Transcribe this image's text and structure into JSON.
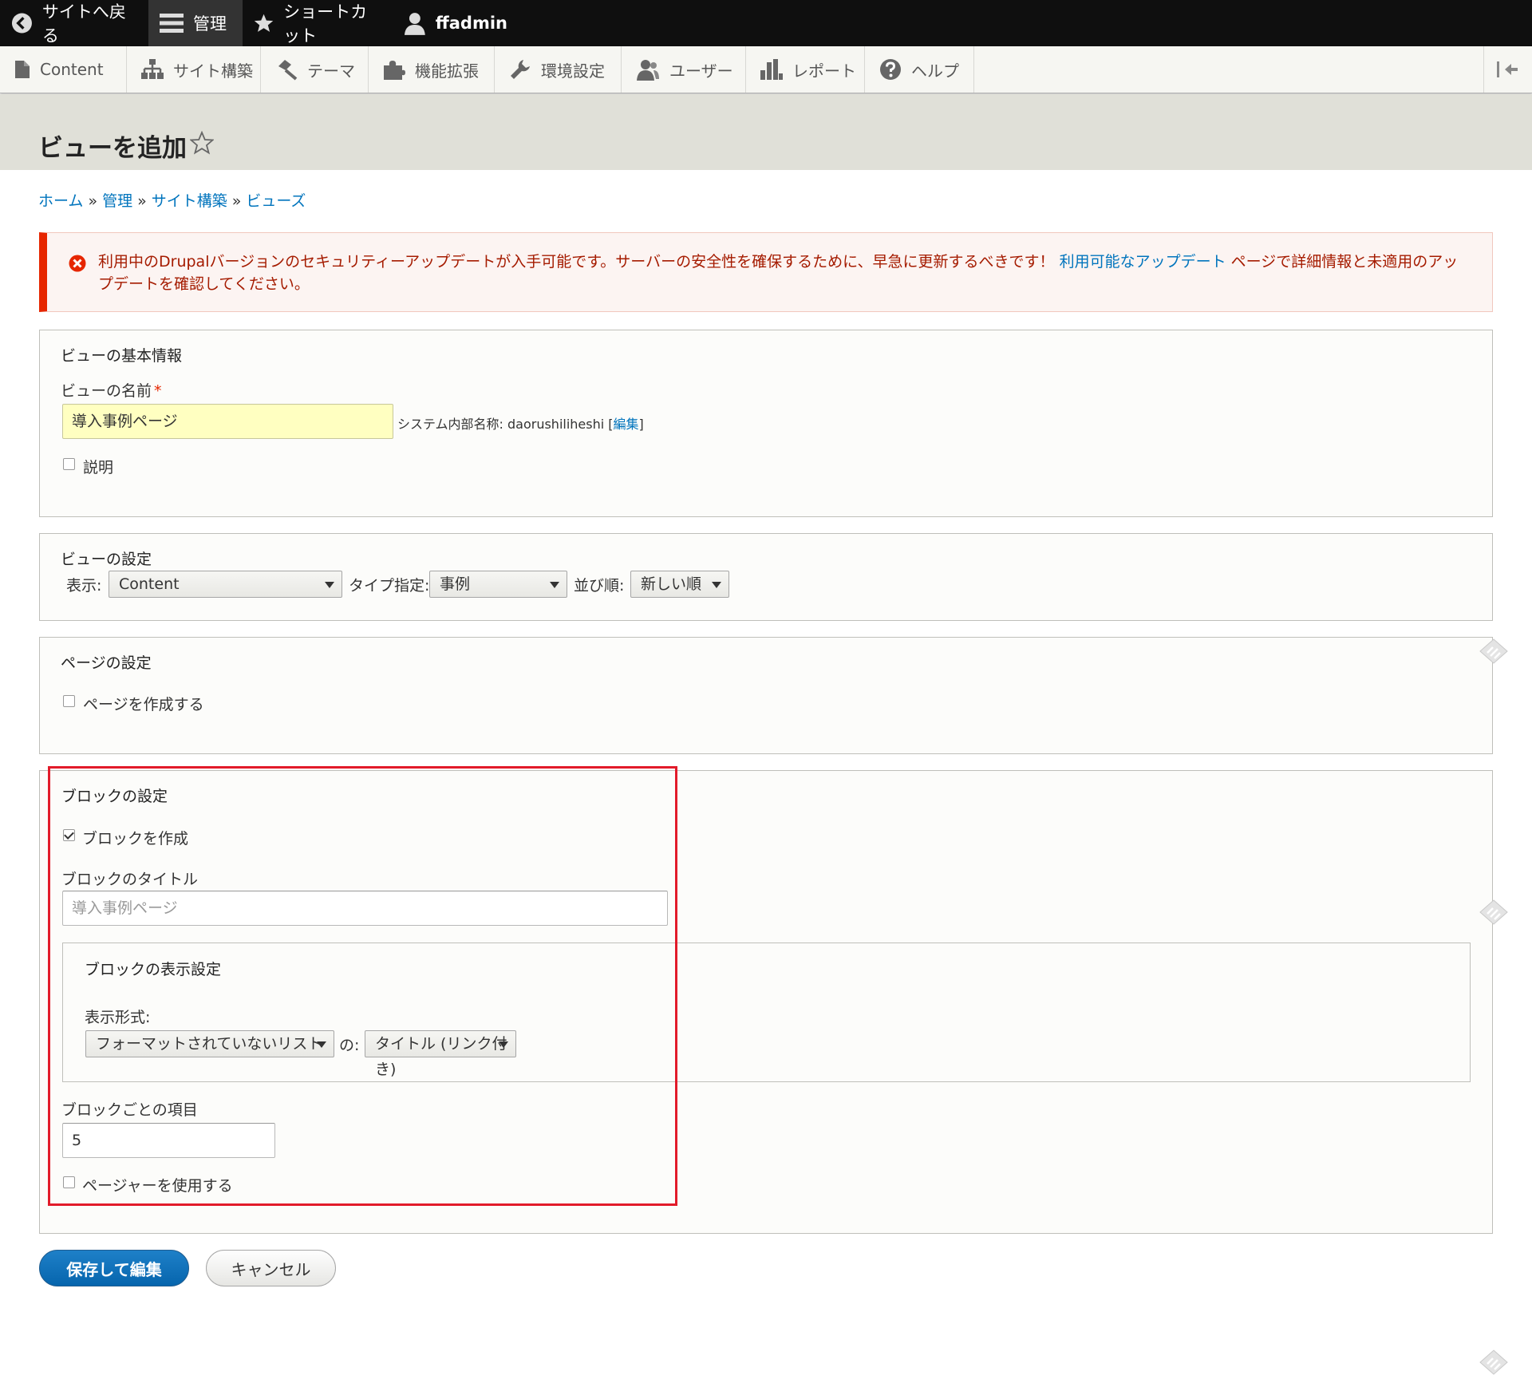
{
  "toolbar": {
    "back_label": "サイトへ戻る",
    "manage_label": "管理",
    "shortcuts_label": "ショートカット",
    "user_label": "ffadmin"
  },
  "tray": {
    "items": [
      {
        "label": "Content"
      },
      {
        "label": "サイト構築"
      },
      {
        "label": "テーマ"
      },
      {
        "label": "機能拡張"
      },
      {
        "label": "環境設定"
      },
      {
        "label": "ユーザー"
      },
      {
        "label": "レポート"
      },
      {
        "label": "ヘルプ"
      }
    ]
  },
  "page": {
    "title": "ビューを追加"
  },
  "breadcrumb": {
    "items": [
      "ホーム",
      "管理",
      "サイト構築",
      "ビューズ"
    ],
    "separator": "»"
  },
  "error": {
    "text_before": "利用中のDrupalバージョンのセキュリティーアップデートが入手可能です。サーバーの安全性を確保するために、早急に更新するべきです！ ",
    "link": "利用可能なアップデート",
    "text_after": " ページで詳細情報と未適用のアップデートを確認してください。"
  },
  "basic": {
    "legend": "ビューの基本情報",
    "name_label": "ビューの名前",
    "required_mark": "*",
    "name_value": "導入事例ページ",
    "machine_prefix": "システム内部名称: daorushiliheshi [",
    "machine_edit": "編集",
    "machine_suffix": "]",
    "description_label": "説明"
  },
  "settings": {
    "legend": "ビューの設定",
    "show_label": "表示:",
    "show_value": "Content",
    "type_label": "タイプ指定:",
    "type_value": "事例",
    "sort_label": "並び順:",
    "sort_value": "新しい順"
  },
  "page_settings": {
    "legend": "ページの設定",
    "create_label": "ページを作成する"
  },
  "block": {
    "legend": "ブロックの設定",
    "create_label": "ブロックを作成",
    "title_label": "ブロックのタイトル",
    "title_placeholder": "導入事例ページ",
    "display_legend": "ブロックの表示設定",
    "format_label": "表示形式:",
    "format_value": "フォーマットされていないリスト",
    "of_label": "の:",
    "item_value": "タイトル (リンク付き)",
    "items_label": "ブロックごとの項目",
    "items_value": "5",
    "pager_label": "ページャーを使用する"
  },
  "actions": {
    "save_label": "保存して編集",
    "cancel_label": "キャンセル"
  },
  "colors": {
    "toolbar_bg": "#0f0f0f",
    "link": "#0074bd",
    "error": "#e62600",
    "primary_button": "#0665ad",
    "highlight": "#e21b2a"
  }
}
